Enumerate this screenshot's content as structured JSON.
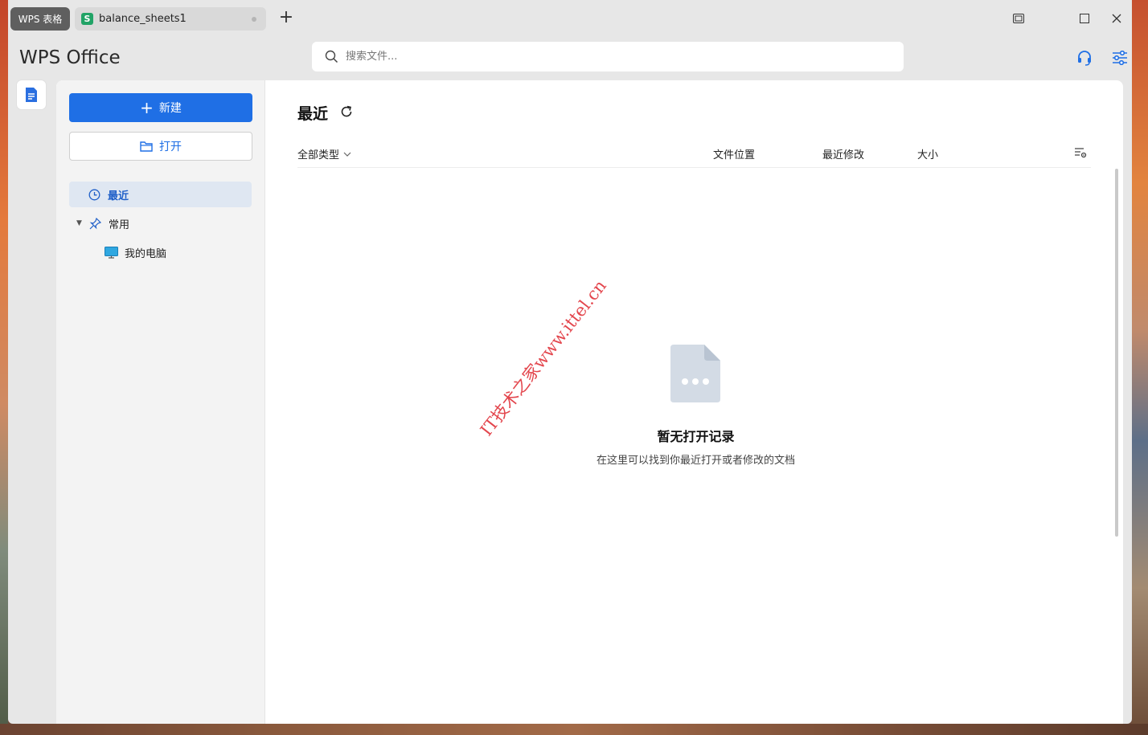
{
  "titlebar": {
    "app_tab_label": "WPS 表格",
    "doc_tab": {
      "icon_letter": "S",
      "label": "balance_sheets1"
    },
    "new_tab_symbol": "+"
  },
  "header": {
    "logo_text": "WPS Office",
    "search": {
      "placeholder": "搜索文件..."
    }
  },
  "sidebar": {
    "new_button": {
      "symbol": "+",
      "label": "新建"
    },
    "open_button": {
      "label": "打开"
    },
    "nav": {
      "recent": "最近",
      "common": "常用",
      "my_computer": "我的电脑"
    }
  },
  "main": {
    "title": "最近",
    "columns": {
      "type_filter": "全部类型",
      "location": "文件位置",
      "modified": "最近修改",
      "size": "大小"
    },
    "empty_state": {
      "title": "暂无打开记录",
      "description": "在这里可以找到你最近打开或者修改的文档"
    }
  },
  "watermark": "IT技术之家www.ittel.cn",
  "colors": {
    "accent": "#1f6fe5",
    "sheet_green": "#21a366",
    "selected_nav_bg": "#dfe7f2"
  },
  "icons": [
    "restore-icon",
    "maximize-icon",
    "close-icon",
    "search-icon",
    "headset-icon",
    "settings-sliders-icon",
    "document-icon",
    "folder-icon",
    "clock-icon",
    "pin-icon",
    "monitor-icon",
    "refresh-icon",
    "chevron-down-icon",
    "column-settings-icon",
    "empty-file-icon"
  ]
}
